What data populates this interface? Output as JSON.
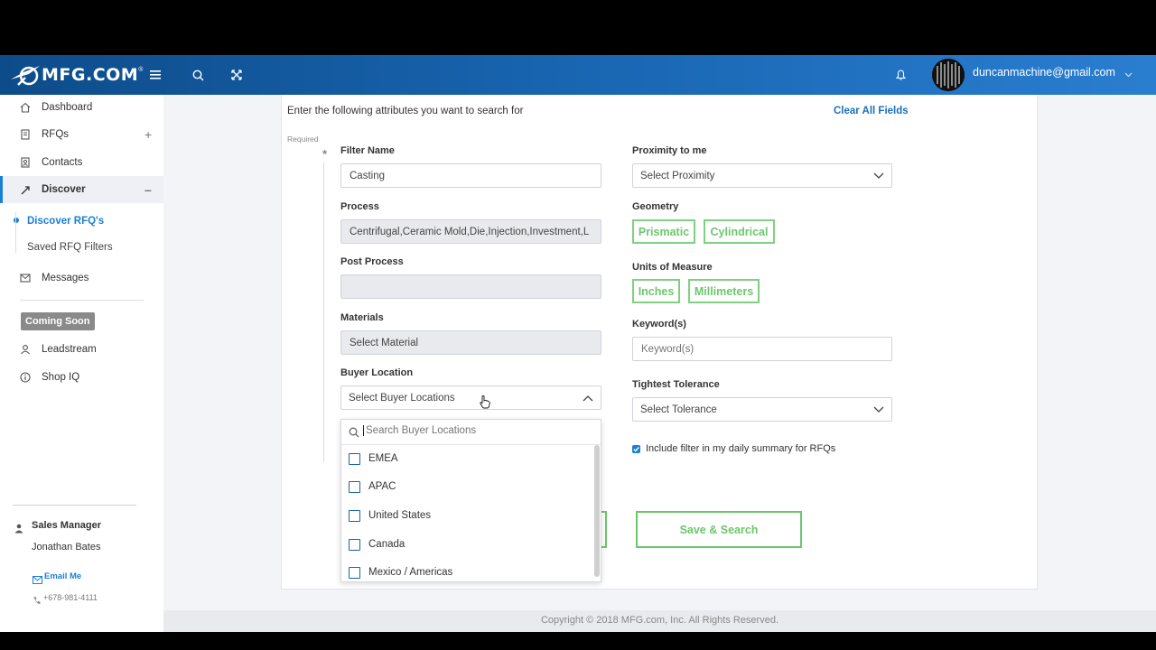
{
  "header": {
    "logo_text": "MFG.COM",
    "logo_reg": "®",
    "user_email": "duncanmachine@gmail.com"
  },
  "sidebar": {
    "items": [
      {
        "label": "Dashboard",
        "icon": "home-icon"
      },
      {
        "label": "RFQs",
        "icon": "document-icon",
        "toggle": "+"
      },
      {
        "label": "Contacts",
        "icon": "contacts-icon"
      },
      {
        "label": "Discover",
        "icon": "discover-icon",
        "toggle": "–"
      },
      {
        "label": "Messages",
        "icon": "mail-icon"
      },
      {
        "label": "Leadstream",
        "icon": "person-icon"
      },
      {
        "label": "Shop IQ",
        "icon": "info-icon"
      }
    ],
    "sub_items": [
      "Discover RFQ's",
      "Saved RFQ Filters"
    ],
    "coming_soon": "Coming Soon",
    "contact": {
      "role": "Sales Manager",
      "name": "Jonathan Bates",
      "email_label": "Email Me",
      "phone": "+678-981-4111"
    }
  },
  "form": {
    "intro": "Enter the following attributes you want to search for",
    "clear_all": "Clear All Fields",
    "required_label": "Required",
    "required_mark": "*",
    "filter_name_label": "Filter Name",
    "filter_name_value": "Casting",
    "process_label": "Process",
    "process_value": "Centrifugal,Ceramic Mold,Die,Injection,Investment,L",
    "post_process_label": "Post Process",
    "post_process_value": "",
    "materials_label": "Materials",
    "materials_value": "Select Material",
    "buyer_location_label": "Buyer Location",
    "buyer_location_value": "Select Buyer Locations",
    "proximity_label": "Proximity to me",
    "proximity_value": "Select Proximity",
    "geometry_label": "Geometry",
    "geometry_options": [
      "Prismatic",
      "Cylindrical"
    ],
    "units_label": "Units of Measure",
    "units_options": [
      "Inches",
      "Millimeters"
    ],
    "keywords_label": "Keyword(s)",
    "keywords_placeholder": "Keyword(s)",
    "tolerance_label": "Tightest Tolerance",
    "tolerance_value": "Select Tolerance",
    "daily_summary_label": "Include filter in my daily summary for RFQs",
    "daily_summary_checked": true,
    "save_search_label": "Save & Search"
  },
  "buyer_location_dropdown": {
    "search_placeholder": "Search Buyer Locations",
    "options": [
      "EMEA",
      "APAC",
      "United States",
      "Canada",
      "Mexico / Americas"
    ]
  },
  "footer": {
    "copyright": "Copyright © 2018 MFG.com, Inc. All Rights Reserved."
  },
  "colors": {
    "header_start": "#0d4c8a",
    "header_end": "#2a7ed0",
    "accent_blue": "#1a7fd4",
    "tag_green": "#6cc76c"
  }
}
